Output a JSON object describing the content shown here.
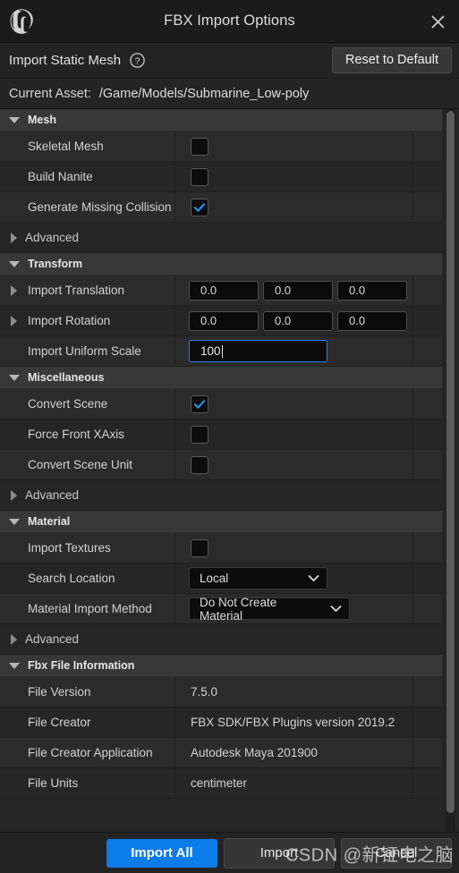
{
  "window": {
    "title": "FBX Import Options",
    "logo_icon": "unreal-engine-logo",
    "close_icon": "close-icon"
  },
  "subheader": {
    "title": "Import Static Mesh",
    "help_icon": "help-circle-icon",
    "reset_label": "Reset to Default"
  },
  "asset": {
    "label": "Current Asset:",
    "path": "/Game/Models/Submarine_Low-poly"
  },
  "sections": [
    {
      "title": "Mesh",
      "rows": [
        {
          "name": "Skeletal Mesh",
          "type": "checkbox",
          "checked": false
        },
        {
          "name": "Build Nanite",
          "type": "checkbox",
          "checked": false
        },
        {
          "name": "Generate Missing Collision",
          "type": "checkbox",
          "checked": true
        }
      ],
      "advanced": "Advanced"
    },
    {
      "title": "Transform",
      "rows": [
        {
          "name": "Import Translation",
          "type": "vector3",
          "values": [
            "0.0",
            "0.0",
            "0.0"
          ],
          "expandable": true
        },
        {
          "name": "Import Rotation",
          "type": "vector3",
          "values": [
            "0.0",
            "0.0",
            "0.0"
          ],
          "expandable": true
        },
        {
          "name": "Import Uniform Scale",
          "type": "text-focused",
          "value": "100"
        }
      ]
    },
    {
      "title": "Miscellaneous",
      "rows": [
        {
          "name": "Convert Scene",
          "type": "checkbox",
          "checked": true
        },
        {
          "name": "Force Front XAxis",
          "type": "checkbox",
          "checked": false
        },
        {
          "name": "Convert Scene Unit",
          "type": "checkbox",
          "checked": false
        }
      ],
      "advanced": "Advanced"
    },
    {
      "title": "Material",
      "rows": [
        {
          "name": "Import Textures",
          "type": "checkbox",
          "checked": false
        },
        {
          "name": "Search Location",
          "type": "dropdown",
          "value": "Local"
        },
        {
          "name": "Material Import Method",
          "type": "dropdown",
          "value": "Do Not Create Material"
        }
      ],
      "advanced": "Advanced"
    },
    {
      "title": "Fbx File Information",
      "rows": [
        {
          "name": "File Version",
          "type": "text",
          "value": "7.5.0"
        },
        {
          "name": "File Creator",
          "type": "text",
          "value": "FBX SDK/FBX Plugins version 2019.2"
        },
        {
          "name": "File Creator Application",
          "type": "text",
          "value": "Autodesk Maya 201900"
        },
        {
          "name": "File Units",
          "type": "text",
          "value": "centimeter"
        }
      ]
    }
  ],
  "footer": {
    "import_all_label": "Import All",
    "import_label": "Import",
    "cancel_label": "Cancel",
    "watermark": "CSDN @新钲电之脑"
  },
  "colors": {
    "accent_blue": "#0c7ce8",
    "focus_border": "#2a85e0",
    "checkbox_check": "#2a8fe8",
    "section_header_bg": "#383838",
    "window_bg": "#242424"
  }
}
